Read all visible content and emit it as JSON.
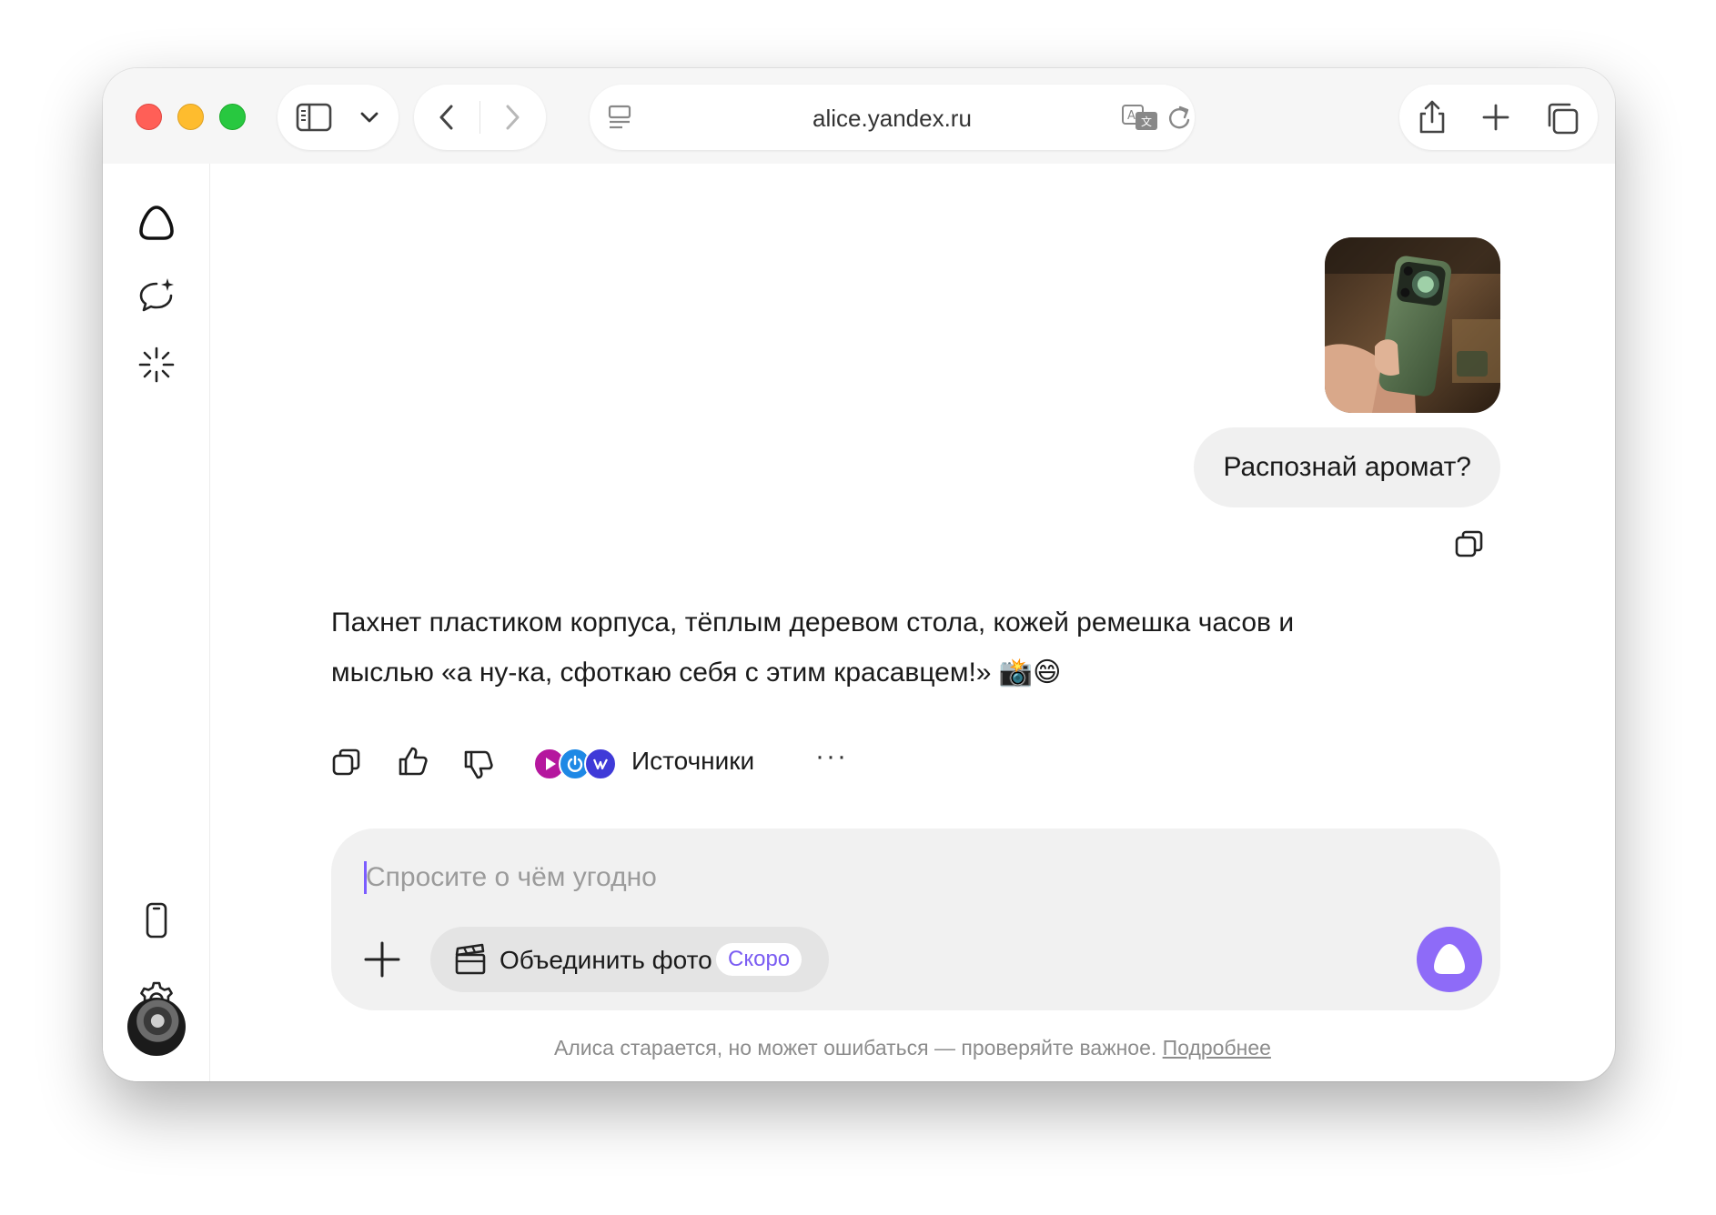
{
  "browser": {
    "url": "alice.yandex.ru"
  },
  "chat": {
    "user_message": "Распознай аромат?",
    "assistant_message": "Пахнет пластиком корпуса, тёплым деревом стола, кожей ремешка часов и мыслью «а ну-ка, сфоткаю себя с этим красавцем!» 📸😄",
    "actions": {
      "sources_label": "Источники",
      "more_label": "···"
    }
  },
  "composer": {
    "placeholder": "Спросите о чём угодно",
    "merge_label": "Объединить фото",
    "soon_badge": "Скоро"
  },
  "footer": {
    "disclaimer": "Алиса старается, но может ошибаться — проверяйте важное.",
    "more_link": "Подробнее"
  },
  "colors": {
    "accent": "#8e6bf8",
    "soon_text": "#7a5cf2",
    "traffic_red": "#ff5f57",
    "traffic_yellow": "#febc2e",
    "traffic_green": "#28c840"
  },
  "icons": {
    "sidebar": [
      "alice-logo-icon",
      "new-chat-icon",
      "sparkle-icon",
      "phone-icon",
      "settings-gear-icon"
    ],
    "toolbar": [
      "sidebar-toggle-icon",
      "chevron-down-icon",
      "back-icon",
      "forward-icon",
      "page-menu-icon",
      "translate-icon",
      "reload-icon",
      "share-icon",
      "new-tab-icon",
      "tabs-overview-icon"
    ]
  }
}
